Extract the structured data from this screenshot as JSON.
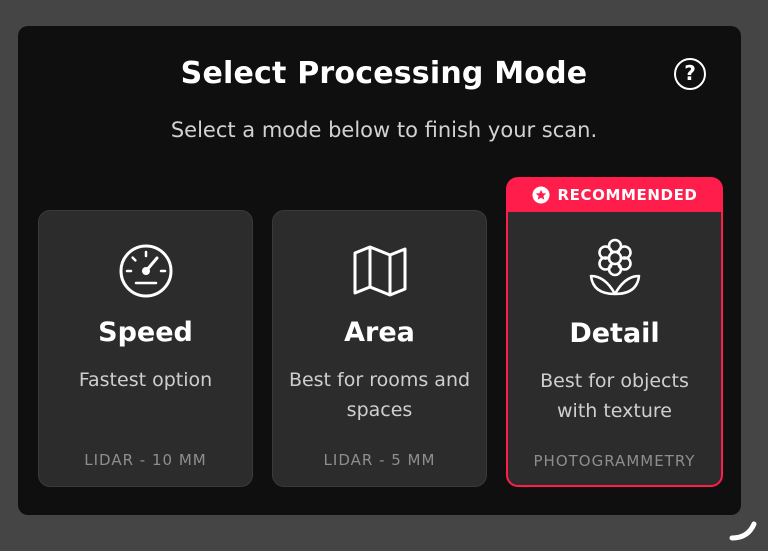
{
  "dialog": {
    "title": "Select Processing Mode",
    "subtitle": "Select a mode below to finish your scan.",
    "help_label": "?"
  },
  "modes": [
    {
      "name": "Speed",
      "description": "Fastest option",
      "technique": "LIDAR - 10 MM",
      "icon": "speedometer-icon"
    },
    {
      "name": "Area",
      "description": "Best for rooms and spaces",
      "technique": "LIDAR - 5 MM",
      "icon": "map-icon"
    },
    {
      "name": "Detail",
      "description": "Best for objects with texture",
      "technique": "PHOTOGRAMMETRY",
      "icon": "flower-icon",
      "badge": "RECOMMENDED",
      "selected": true
    }
  ],
  "colors": {
    "accent": "#ff1e4b",
    "panel": "#0f0f0f",
    "card": "#2c2c2c",
    "background": "#454545"
  }
}
